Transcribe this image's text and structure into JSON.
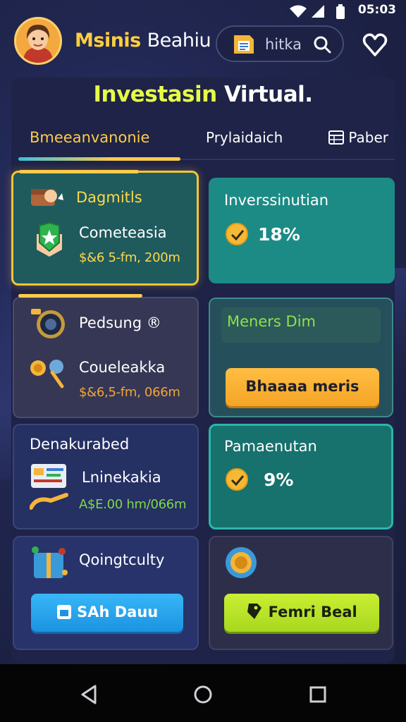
{
  "status": {
    "time": "05:03"
  },
  "header": {
    "app_name_a": "Msinis",
    "app_name_b": "Beahiu",
    "search_text": "hitka"
  },
  "title": {
    "part_a": "Investasin",
    "part_b": "Virtual."
  },
  "tabs": [
    {
      "label": "Bmeeanvanonie",
      "active": true
    },
    {
      "label": "Prylaidaich"
    },
    {
      "label": "Paber"
    }
  ],
  "cards": {
    "c1": {
      "title": "Dagmitls",
      "subtitle": "Cometeasia",
      "amount": "$&6 5-fm, 200m"
    },
    "c2": {
      "title": "Inverssinutian",
      "percent": "18%"
    },
    "c3": {
      "title": "Pedsung ®",
      "subtitle": "Coueleakka",
      "amount": "$&6,5-fm, 066m"
    },
    "c4": {
      "title": "Meners Dim",
      "button": "Bhaaaa meris"
    },
    "c5": {
      "title": "Denakurabed",
      "subtitle": "Lninekakia",
      "amount": "A$E.00 hm/066m"
    },
    "c6": {
      "title": "Pamaenutan",
      "percent": "9%"
    },
    "c7": {
      "title": "Qoingtculty",
      "button": "SAh Dauu"
    },
    "c8": {
      "button": "Femri Beal"
    }
  },
  "colors": {
    "accent_yellow": "#ffd84a",
    "accent_teal": "#1c8b85",
    "button_orange": "#f5a526",
    "button_blue": "#1c93e2",
    "button_green": "#a8d81f"
  }
}
